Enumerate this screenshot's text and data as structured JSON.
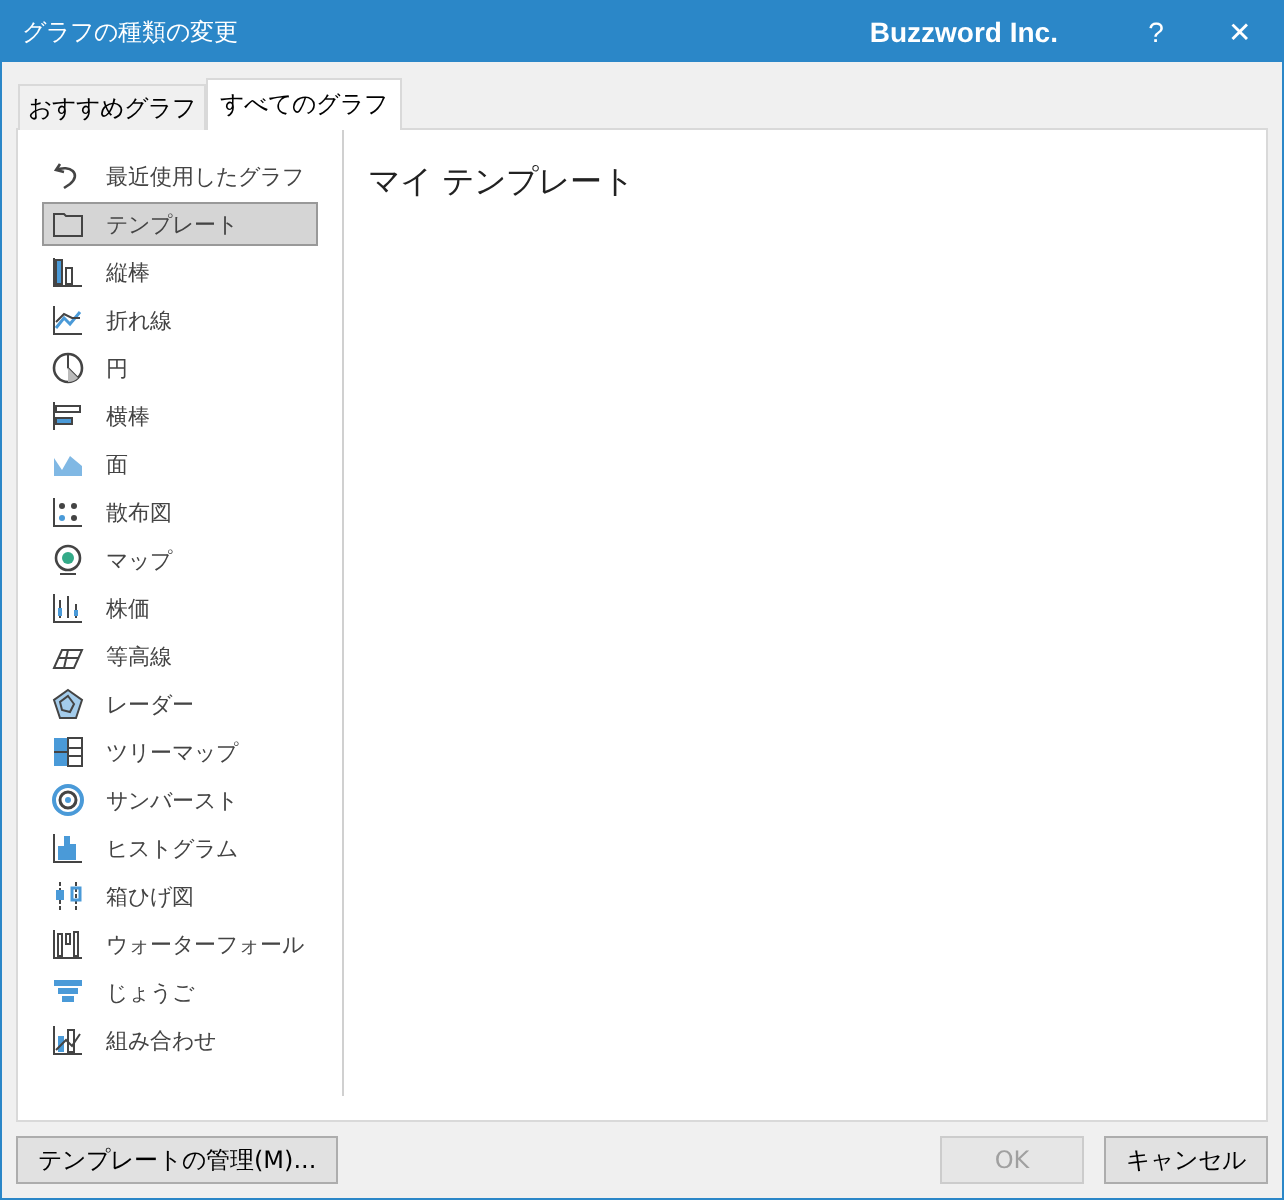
{
  "window": {
    "title": "グラフの種類の変更",
    "brand": "Buzzword Inc.",
    "help": "?",
    "close": "✕"
  },
  "tabs": [
    {
      "label": "おすすめグラフ",
      "selected": false
    },
    {
      "label": "すべてのグラフ",
      "selected": true
    }
  ],
  "sidebar": {
    "items": [
      {
        "label": "最近使用したグラフ",
        "selected": false
      },
      {
        "label": "テンプレート",
        "selected": true
      },
      {
        "label": "縦棒",
        "selected": false
      },
      {
        "label": "折れ線",
        "selected": false
      },
      {
        "label": "円",
        "selected": false
      },
      {
        "label": "横棒",
        "selected": false
      },
      {
        "label": "面",
        "selected": false
      },
      {
        "label": "散布図",
        "selected": false
      },
      {
        "label": "マップ",
        "selected": false
      },
      {
        "label": "株価",
        "selected": false
      },
      {
        "label": "等高線",
        "selected": false
      },
      {
        "label": "レーダー",
        "selected": false
      },
      {
        "label": "ツリーマップ",
        "selected": false
      },
      {
        "label": "サンバースト",
        "selected": false
      },
      {
        "label": "ヒストグラム",
        "selected": false
      },
      {
        "label": "箱ひげ図",
        "selected": false
      },
      {
        "label": "ウォーターフォール",
        "selected": false
      },
      {
        "label": "じょうご",
        "selected": false
      },
      {
        "label": "組み合わせ",
        "selected": false
      }
    ]
  },
  "content": {
    "heading": "マイ テンプレート"
  },
  "buttons": [
    {
      "label": "テンプレートの管理(M)...",
      "disabled": false
    },
    {
      "label": "OK",
      "disabled": true
    },
    {
      "label": "キャンセル",
      "disabled": false
    }
  ]
}
